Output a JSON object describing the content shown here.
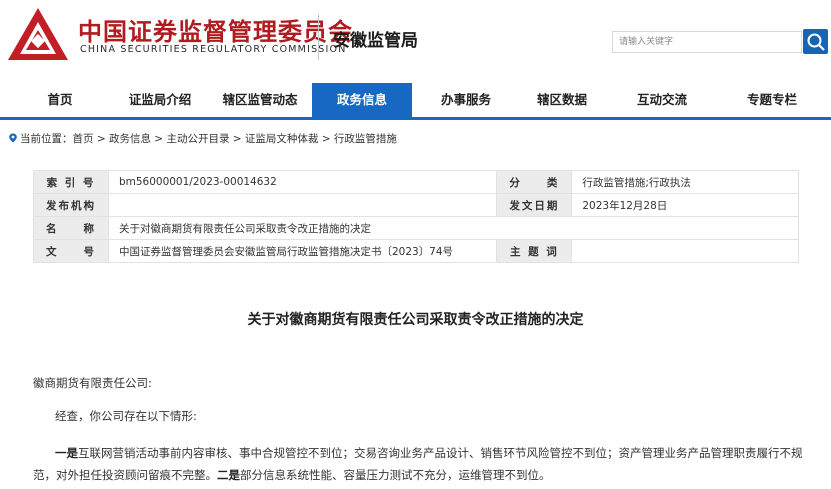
{
  "header": {
    "title_cn": "中国证券监督管理委员会",
    "title_en": "CHINA SECURITIES REGULATORY COMMISSION",
    "bureau": "安徽监管局",
    "search_placeholder": "请输入关键字",
    "brand_color": "#b11a1f",
    "accent_color": "#1668c3"
  },
  "nav": {
    "items": [
      {
        "label": "首页"
      },
      {
        "label": "证监局介绍"
      },
      {
        "label": "辖区监管动态"
      },
      {
        "label": "政务信息",
        "active": true
      },
      {
        "label": "办事服务"
      },
      {
        "label": "辖区数据"
      },
      {
        "label": "互动交流"
      },
      {
        "label": "专题专栏"
      }
    ]
  },
  "breadcrumb": "当前位置：首页 > 政务信息 > 主动公开目录 > 证监局文种体裁 > 行政监管措施",
  "info": {
    "index_label": "索 引 号",
    "index_value": "bm56000001/2023-00014632",
    "category_label": "分　　类",
    "category_value": "行政监管措施;行政执法",
    "publisher_label": "发布机构",
    "publisher_value": "",
    "date_label": "发文日期",
    "date_value": "2023年12月28日",
    "name_label": "名　　称",
    "name_value": "关于对徽商期货有限责任公司采取责令改正措施的决定",
    "docno_label": "文　　号",
    "docno_value": "中国证券监督管理委员会安徽监管局行政监管措施决定书〔2023〕74号",
    "subject_label": "主 题 词",
    "subject_value": ""
  },
  "article": {
    "title": "关于对徽商期货有限责任公司采取责令改正措施的决定",
    "addressee": "徽商期货有限责任公司:",
    "intro": "经查，你公司存在以下情形:",
    "body_1_bold": "一是",
    "body_1": "互联网营销活动事前内容审核、事中合规管控不到位；交易咨询业务产品设计、销售环节风险管控不到位；资产管理业务产品管理职责履行不规范，对外担任投资顾问留痕不完整。",
    "body_2_bold": "二是",
    "body_2": "部分信息系统性能、容量压力测试不充分，运维管理不到位。"
  }
}
